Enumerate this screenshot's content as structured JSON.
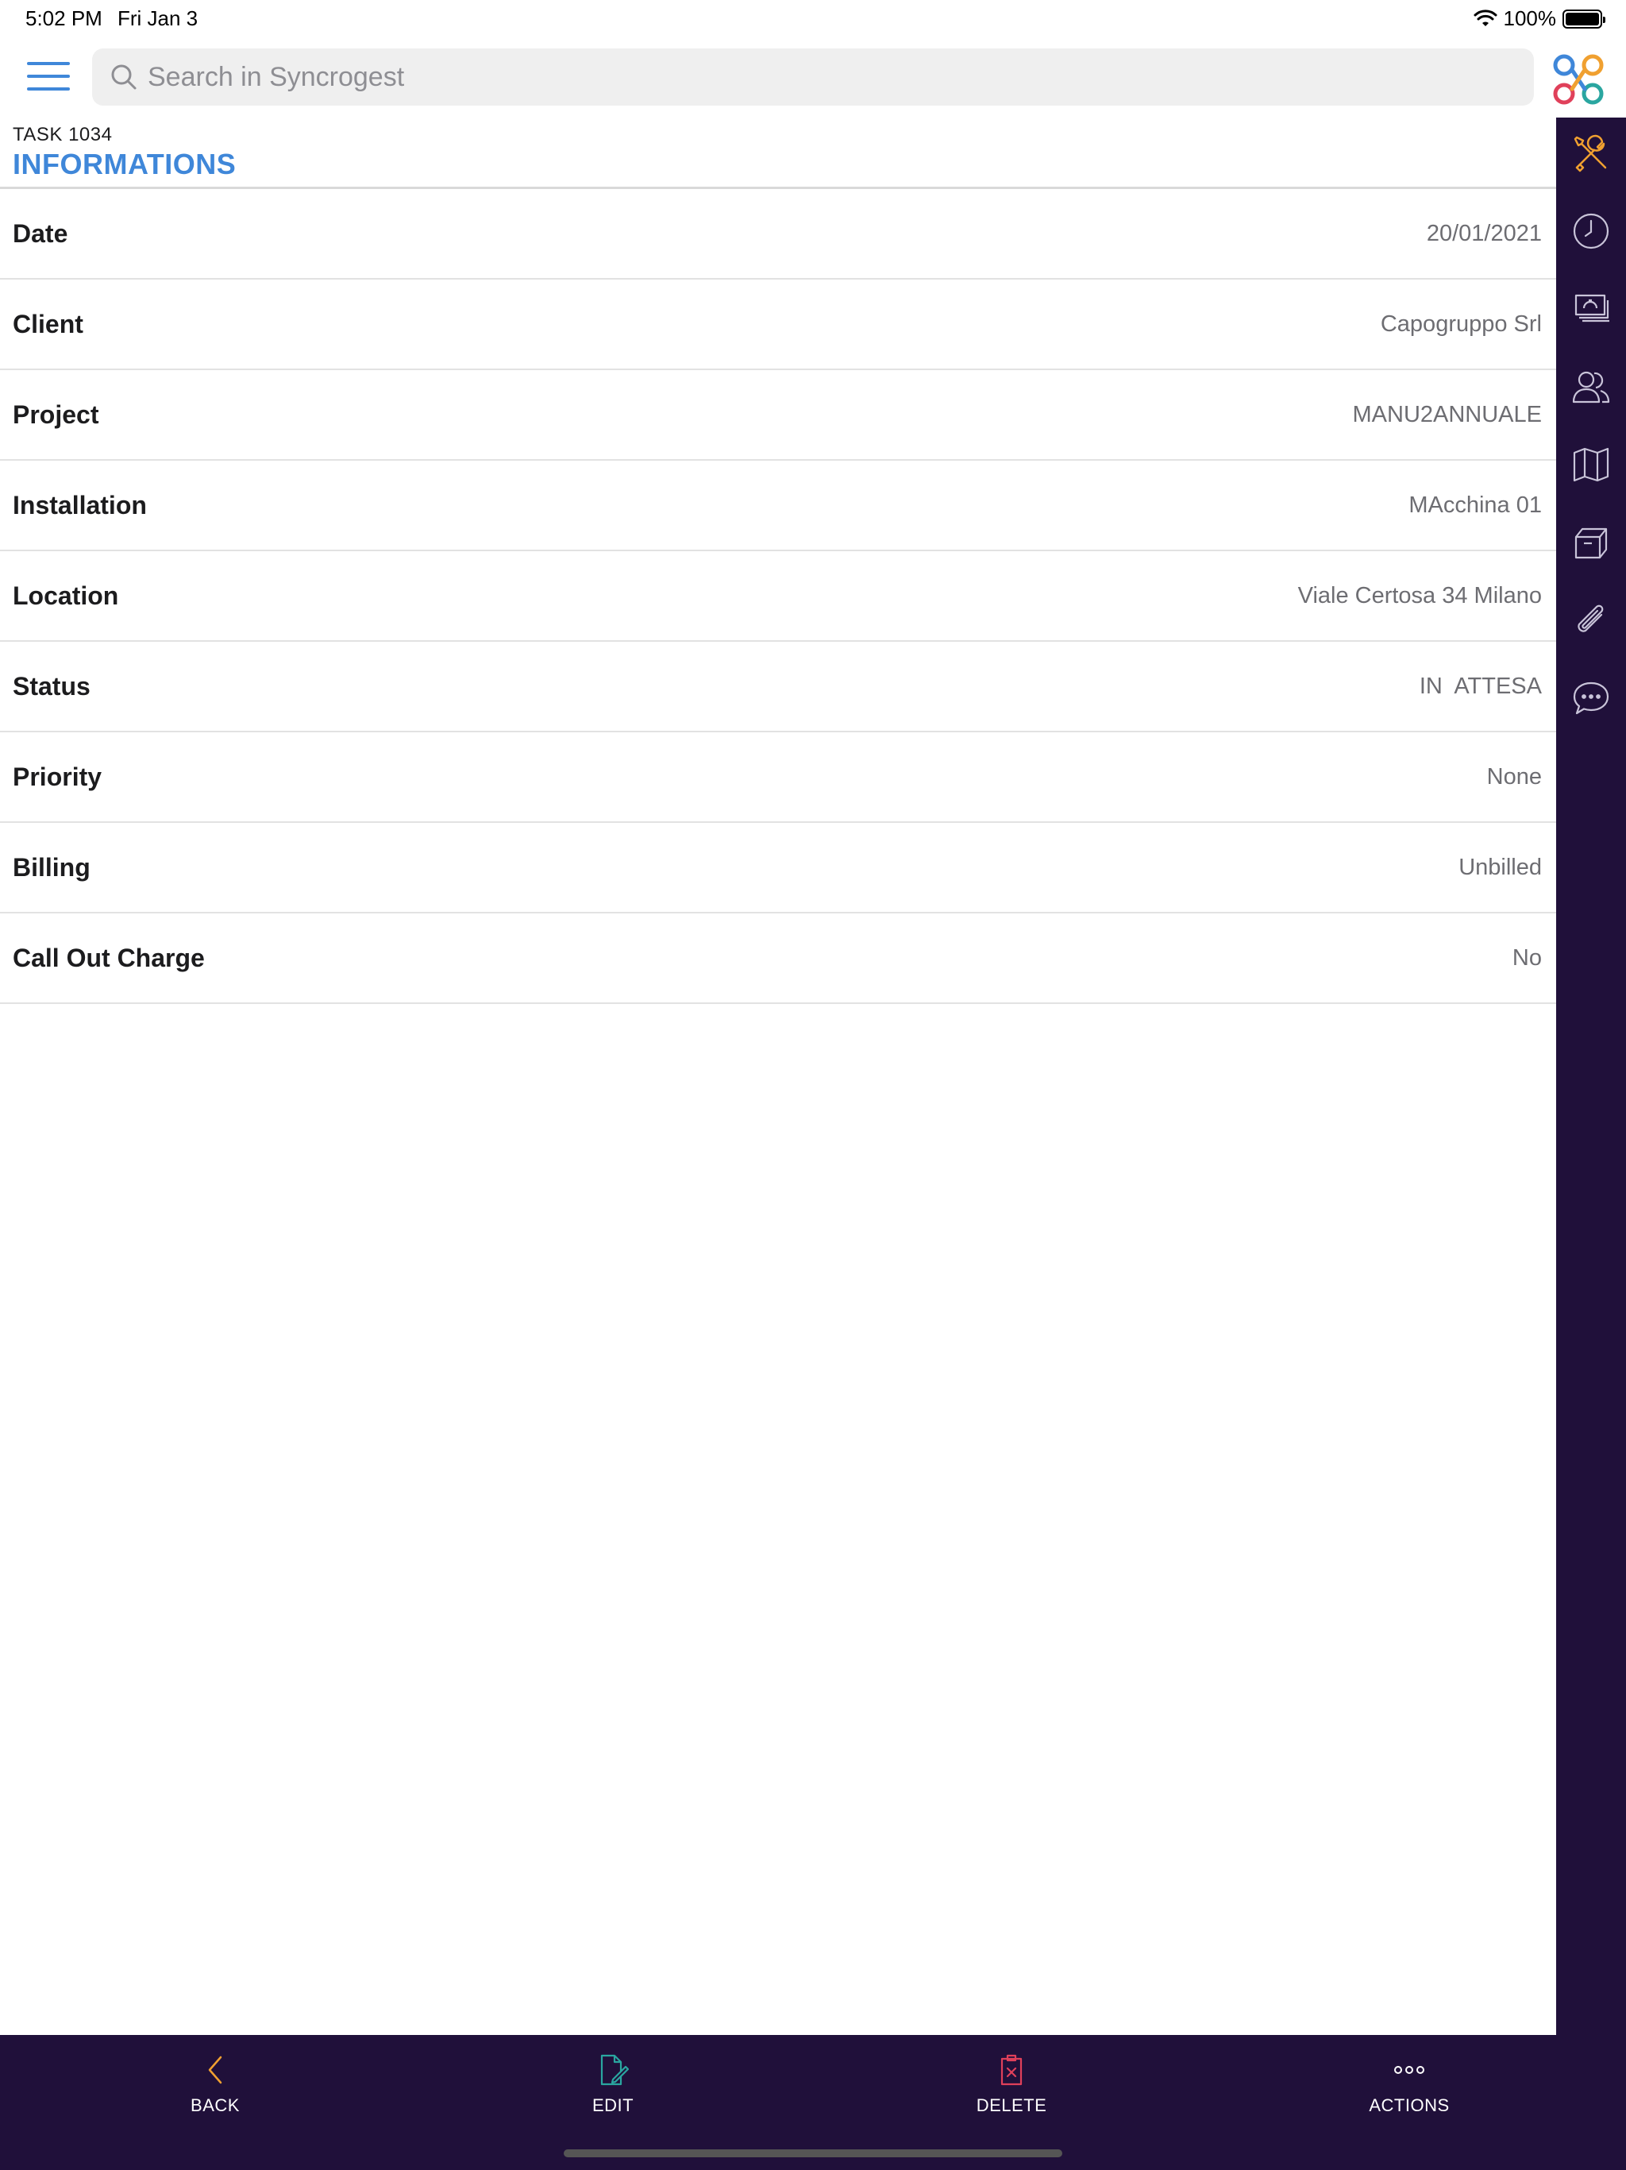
{
  "status_bar": {
    "time": "5:02 PM",
    "date": "Fri Jan 3",
    "battery": "100%"
  },
  "search": {
    "placeholder": "Search in Syncrogest"
  },
  "header": {
    "task_code": "TASK 1034",
    "section_title": "INFORMATIONS"
  },
  "info": {
    "rows": [
      {
        "label": "Date",
        "value": "20/01/2021"
      },
      {
        "label": "Client",
        "value": "Capogruppo Srl"
      },
      {
        "label": "Project",
        "value": "MANU2ANNUALE"
      },
      {
        "label": "Installation",
        "value": "MAcchina 01"
      },
      {
        "label": "Location",
        "value": "Viale Certosa 34 Milano"
      },
      {
        "label": "Status",
        "value": "IN  ATTESA"
      },
      {
        "label": "Priority",
        "value": "None"
      },
      {
        "label": "Billing",
        "value": "Unbilled"
      },
      {
        "label": "Call Out Charge",
        "value": "No"
      }
    ]
  },
  "rail": {
    "items": [
      "tools-icon",
      "clock-icon",
      "money-icon",
      "people-icon",
      "map-icon",
      "box-icon",
      "paperclip-icon",
      "chat-icon"
    ],
    "active": "tools-icon"
  },
  "bottom_bar": {
    "back": "BACK",
    "edit": "EDIT",
    "delete": "DELETE",
    "actions": "ACTIONS"
  },
  "colors": {
    "accent": "#3f87d9",
    "dark_bar": "#20103a",
    "orange": "#f0a030",
    "teal": "#2aa6a0",
    "red": "#e0405a"
  }
}
